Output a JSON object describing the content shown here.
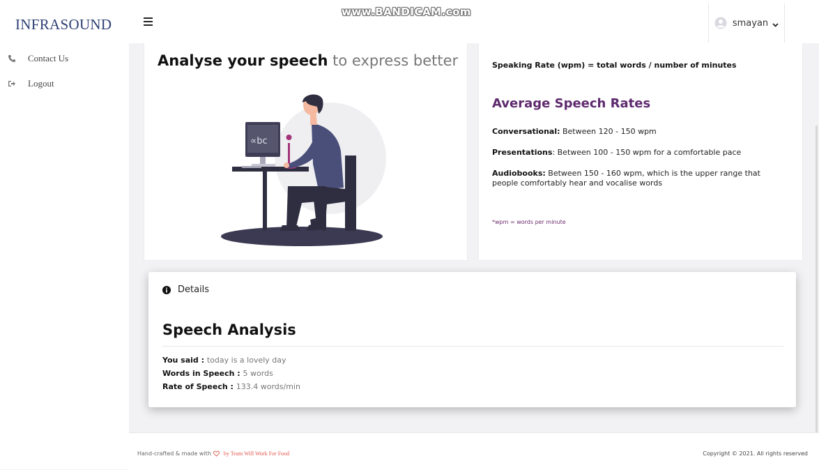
{
  "brand": "INFRASOUND",
  "watermark": "www.BANDICAM.com",
  "sidebar": {
    "items": [
      {
        "label": "Contact Us",
        "icon": "phone-icon"
      },
      {
        "label": "Logout",
        "icon": "logout-icon"
      }
    ]
  },
  "header": {
    "username": "smayan"
  },
  "hero": {
    "headline_bold": "Analyse your speech",
    "headline_light": "to express better",
    "screen_text": "∝bc"
  },
  "rates": {
    "formula": "Speaking Rate (wpm) = total words / number of minutes",
    "title": "Average Speech Rates",
    "conversational_label": "Conversational:",
    "conversational_text": " Between 120 - 150 wpm",
    "presentations_label": "Presentations",
    "presentations_text": ": Between 100 - 150 wpm for a comfortable pace",
    "audiobooks_label": "Audiobooks:",
    "audiobooks_text": " Between 150 - 160 wpm, which is the upper range that people comfortably hear and vocalise words",
    "note": "*wpm = words per minute"
  },
  "details": {
    "heading": "Details",
    "title": "Speech Analysis",
    "you_said_label": "You said : ",
    "you_said_value": "today is a lovely day",
    "words_label": "Words in Speech : ",
    "words_value": "5 words",
    "rate_label": "Rate of Speech : ",
    "rate_value": "133.4 words/min"
  },
  "footer": {
    "left_text": "Hand-crafted & made with",
    "team_text": "by Team Will Work For Food",
    "right_text": "Copyright © 2021. All rights reserved"
  },
  "colors": {
    "brand": "#2c3e73",
    "accent_purple": "#5e2a6e",
    "footer_link": "#e2564d",
    "figure_shirt": "#4a4f7a",
    "figure_dark": "#2f2e41",
    "mic_pink": "#a3357a"
  }
}
